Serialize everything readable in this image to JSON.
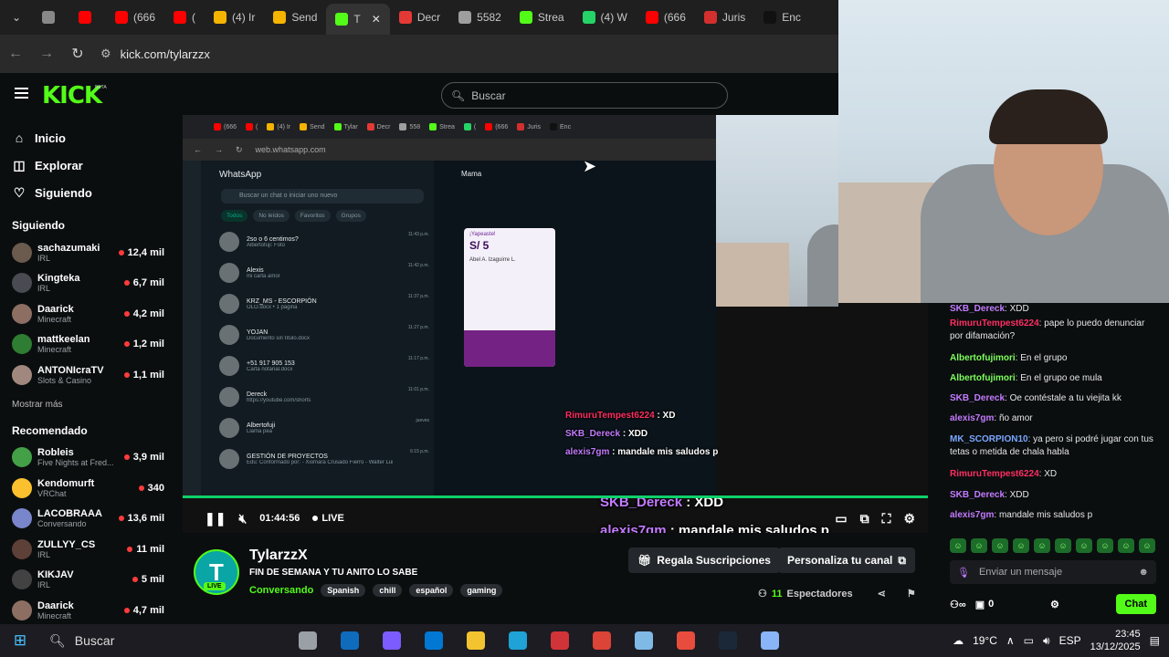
{
  "browser": {
    "tabs": [
      {
        "label": "",
        "color": "#888888"
      },
      {
        "label": "",
        "color": "#ff0000"
      },
      {
        "label": "(666",
        "color": "#ff0000"
      },
      {
        "label": "(",
        "color": "#ff0000"
      },
      {
        "label": "(4) Ir",
        "color": "#f4b400"
      },
      {
        "label": "Send",
        "color": "#f4b400"
      },
      {
        "label": "T",
        "color": "#53fc18",
        "active": true
      },
      {
        "label": "Decr",
        "color": "#e53935"
      },
      {
        "label": "5582",
        "color": "#9e9e9e"
      },
      {
        "label": "Strea",
        "color": "#53fc18"
      },
      {
        "label": "(4) W",
        "color": "#25d366"
      },
      {
        "label": "(666",
        "color": "#ff0000"
      },
      {
        "label": "Juris",
        "color": "#d32f2f"
      },
      {
        "label": "Enc",
        "color": "#111111"
      }
    ],
    "url": "kick.com/tylarzzx"
  },
  "kick": {
    "logo": "KICK",
    "beta": "BETA",
    "search_placeholder": "Buscar",
    "nav": [
      {
        "label": "Inicio",
        "icon": "home-icon"
      },
      {
        "label": "Explorar",
        "icon": "compass-icon"
      },
      {
        "label": "Siguiendo",
        "icon": "heart-icon"
      }
    ],
    "following_title": "Siguiendo",
    "following": [
      {
        "name": "sachazumaki",
        "category": "IRL",
        "viewers": "12,4 mil",
        "color": "#6b5a4e"
      },
      {
        "name": "Kingteka",
        "category": "IRL",
        "viewers": "6,7 mil",
        "color": "#4a4a52"
      },
      {
        "name": "Daarick",
        "category": "Minecraft",
        "viewers": "4,2 mil",
        "color": "#8d6e63"
      },
      {
        "name": "mattkeelan",
        "category": "Minecraft",
        "viewers": "1,2 mil",
        "color": "#2e7d32"
      },
      {
        "name": "ANTONIcraTV",
        "category": "Slots & Casino",
        "viewers": "1,1 mil",
        "color": "#a1887f"
      }
    ],
    "show_more": "Mostrar más",
    "recommended_title": "Recomendado",
    "recommended": [
      {
        "name": "Robleis",
        "category": "Five Nights at Fred...",
        "viewers": "3,9 mil",
        "color": "#43a047"
      },
      {
        "name": "Kendomurft",
        "category": "VRChat",
        "viewers": "340",
        "color": "#fbc02d"
      },
      {
        "name": "LACOBRAAA",
        "category": "Conversando",
        "viewers": "13,6 mil",
        "color": "#7986cb"
      },
      {
        "name": "ZULLYY_CS",
        "category": "IRL",
        "viewers": "11 mil",
        "color": "#5d4037"
      },
      {
        "name": "KIKJAV",
        "category": "IRL",
        "viewers": "5 mil",
        "color": "#424242"
      },
      {
        "name": "Daarick",
        "category": "Minecraft",
        "viewers": "4,7 mil",
        "color": "#8d6e63"
      }
    ]
  },
  "video": {
    "inner_url": "web.whatsapp.com",
    "inner_tabs": [
      "(666",
      "(",
      "(4) Ir",
      "Send",
      "Tylar",
      "Decr",
      "558",
      "Strea",
      "(",
      "(666",
      "Juris",
      "Enc"
    ],
    "whatsapp": {
      "title": "WhatsApp",
      "search_placeholder": "Buscar un chat o iniciar uno nuevo",
      "filters": [
        "Todos",
        "No leídos",
        "Favoritos",
        "Grupos"
      ],
      "contact": "Mama",
      "chats": [
        {
          "name": "2so o 6 centimos?",
          "msg": "Albertofuji: Foto",
          "time": "11:43 p.m."
        },
        {
          "name": "Alexis",
          "msg": "mi carta amor",
          "time": "11:42 p.m."
        },
        {
          "name": "KRZ_MS - ESCORPIÓN",
          "msg": "OLO.docx • 1 página",
          "time": "11:37 p.m."
        },
        {
          "name": "YOJAN",
          "msg": "Documento sin título.docx",
          "time": "11:27 p.m."
        },
        {
          "name": "+51 917 905 153",
          "msg": "Carta notarial.docx",
          "time": "11:17 p.m."
        },
        {
          "name": "Dereck",
          "msg": "https://youtube.com/shorts",
          "time": "11:01 p.m."
        },
        {
          "name": "Albertofuji",
          "msg": "Llama pea",
          "time": "jueves"
        },
        {
          "name": "GESTIÓN DE PROYECTOS",
          "msg": "Edu: Conformado por: - Xiomara Crusado Fierro - Walter Luis Tin...",
          "time": "6:15 p.m."
        }
      ],
      "yape": {
        "header": "¡Yapeaste!",
        "amount": "S/ 5",
        "to": "Abel A. Izaguirre L."
      }
    },
    "overlay_small": [
      {
        "user": "RimuruTempest6224",
        "text": "XD",
        "color": "#ff2e63"
      },
      {
        "user": "SKB_Dereck",
        "text": "XDD",
        "color": "#c37bff"
      },
      {
        "user": "alexis7gm",
        "text": "mandale mis saludos p",
        "color": "#c37bff"
      }
    ],
    "overlay_big": [
      {
        "user": "SKB_Dereck",
        "text": "XDD",
        "color": "#c37bff"
      },
      {
        "user": "alexis7gm",
        "text": "mandale mis saludos p",
        "color": "#c37bff"
      }
    ],
    "controls": {
      "time": "01:44:56",
      "live": "LIVE"
    },
    "progress": 1.0
  },
  "chat": {
    "messages": [
      {
        "user": "SKB_Dereck",
        "text": "XDD",
        "color": "#c37bff"
      },
      {
        "user": "RimuruTempest6224",
        "text": "pape lo puedo denunciar por difamación?",
        "color": "#ff2e63"
      },
      {
        "user": "Albertofujimori",
        "text": "En el grupo",
        "color": "#7cff5b"
      },
      {
        "user": "Albertofujimori",
        "text": "En el grupo oe mula",
        "color": "#7cff5b"
      },
      {
        "user": "SKB_Dereck",
        "text": "Oe contéstale a tu viejita kk",
        "color": "#c37bff"
      },
      {
        "user": "alexis7gm",
        "text": "ño amor",
        "color": "#c37bff"
      },
      {
        "user": "MK_SCORPION10",
        "text": "ya pero si podré jugar con tus tetas o metida de chala habla",
        "color": "#79a7ff"
      },
      {
        "user": "RimuruTempest6224",
        "text": "XD",
        "color": "#ff2e63"
      },
      {
        "user": "SKB_Dereck",
        "text": "XDD",
        "color": "#c37bff"
      },
      {
        "user": "alexis7gm",
        "text": "mandale mis saludos p",
        "color": "#c37bff"
      }
    ],
    "input_placeholder": "Enviar un mensaje",
    "points": "0",
    "chat_button": "Chat"
  },
  "stream": {
    "streamer": "TylarzzX",
    "title": "FIN DE SEMANA Y TU ANITO LO SABE",
    "category": "Conversando",
    "tags": [
      "Spanish",
      "chill",
      "español",
      "gaming"
    ],
    "live_badge": "LIVE",
    "gift_button": "Regala Suscripciones",
    "customize_button": "Personaliza tu canal",
    "viewers": "11",
    "viewers_label": "Espectadores"
  },
  "taskbar": {
    "search_placeholder": "Buscar",
    "weather": "19°C",
    "language": "ESP",
    "time": "23:45",
    "date": "13/12/2025"
  }
}
